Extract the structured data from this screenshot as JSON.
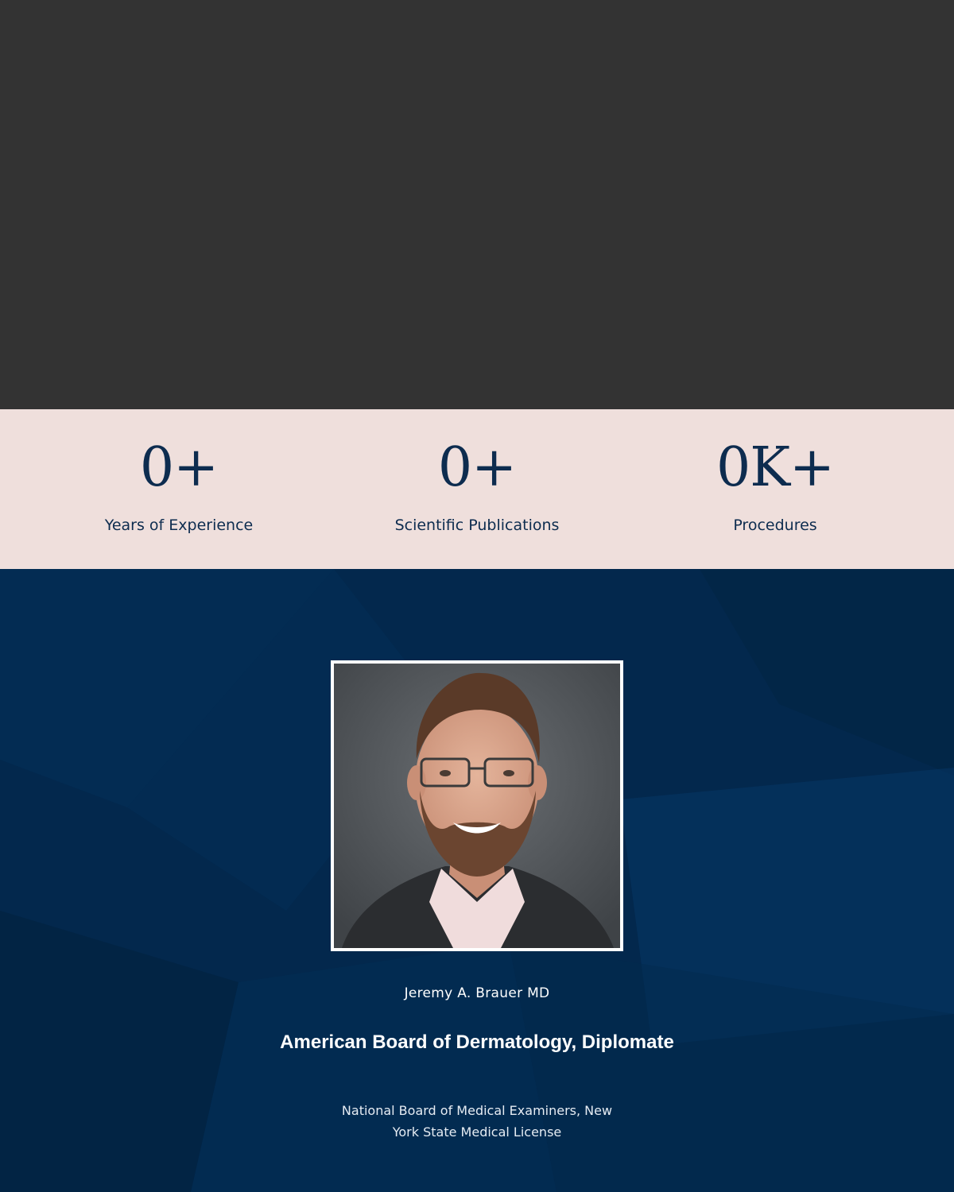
{
  "stats": [
    {
      "value": "0+",
      "label": "Years of Experience"
    },
    {
      "value": "0+",
      "label": "Scientific Publications"
    },
    {
      "value": "0K+",
      "label": "Procedures"
    }
  ],
  "profile": {
    "name": "Jeremy A. Brauer MD",
    "credential_title": "American Board of Dermatology, Diplomate",
    "credential_subtitle": "National Board of Medical Examiners, New York State Medical License"
  },
  "colors": {
    "hero_bg": "#333333",
    "stats_bg": "#efdfdc",
    "stats_text": "#0d2c4f",
    "bio_bg": "#03284d",
    "frame": "#ffffff"
  }
}
